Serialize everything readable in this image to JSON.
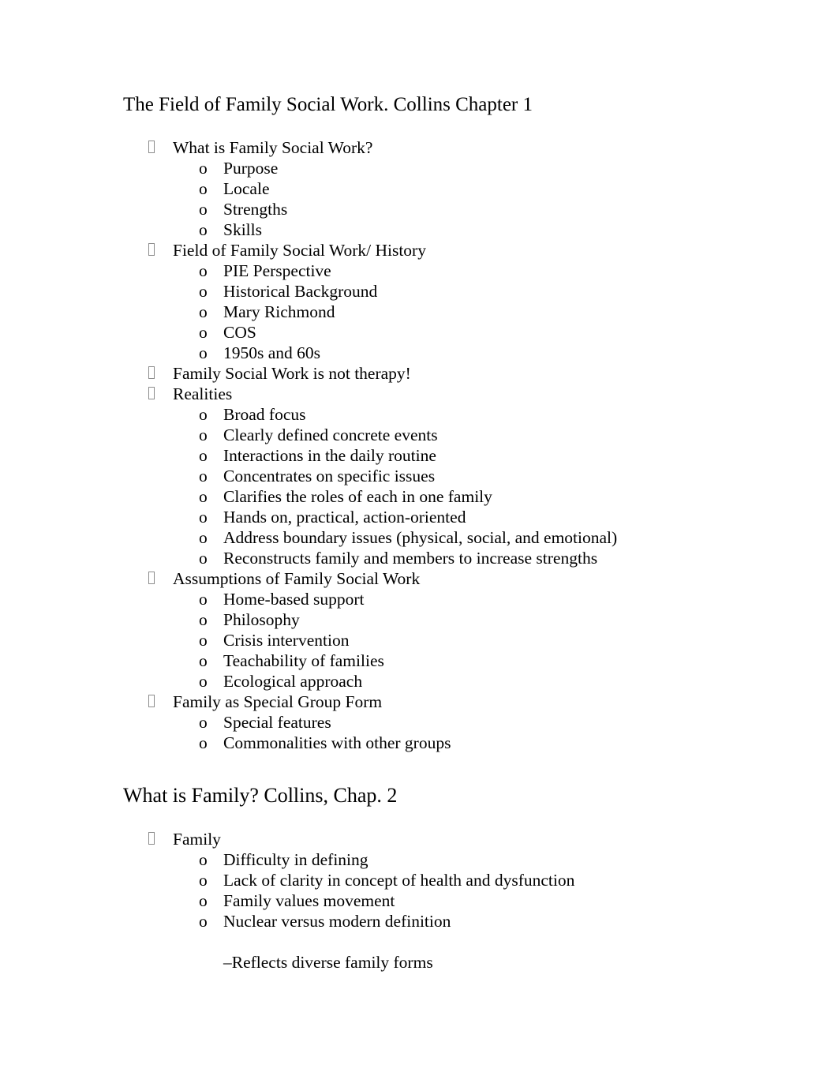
{
  "document": {
    "bullet_glyph_level1": "□",
    "bullet_glyph_level2": "o",
    "text_color": "#000000",
    "background_color": "#ffffff",
    "bullet_marker_color": "#8c8c8c"
  },
  "sections": [
    {
      "heading": "The Field of Family Social Work. Collins Chapter 1",
      "items": [
        {
          "label": "What is Family Social Work?",
          "children": [
            "Purpose",
            "Locale",
            "Strengths",
            "Skills"
          ]
        },
        {
          "label": "Field of Family Social Work/ History",
          "children": [
            "PIE Perspective",
            "Historical Background",
            "Mary Richmond",
            "COS",
            "1950s and 60s"
          ]
        },
        {
          "label": "Family Social Work is not therapy!",
          "children": []
        },
        {
          "label": "Realities",
          "children": [
            "Broad focus",
            "Clearly defined concrete events",
            "Interactions in the daily routine",
            "Concentrates on specific issues",
            "Clarifies the roles of each in one family",
            "Hands on, practical, action-oriented",
            "Address boundary issues (physical, social, and emotional)",
            "Reconstructs family and members to increase strengths"
          ]
        },
        {
          "label": "Assumptions of Family Social Work",
          "children": [
            "Home-based support",
            "Philosophy",
            "Crisis intervention",
            "Teachability of families",
            "Ecological approach"
          ]
        },
        {
          "label": "Family as Special Group Form",
          "children": [
            "Special features",
            "Commonalities with other groups"
          ]
        }
      ]
    },
    {
      "heading": "What is Family? Collins, Chap. 2",
      "items": [
        {
          "label": "Family",
          "children": [
            "Difficulty in defining",
            "Lack of clarity in concept of health and dysfunction",
            "Family values movement",
            "Nuclear versus modern definition"
          ],
          "note": "–Reflects diverse family forms"
        }
      ]
    }
  ]
}
